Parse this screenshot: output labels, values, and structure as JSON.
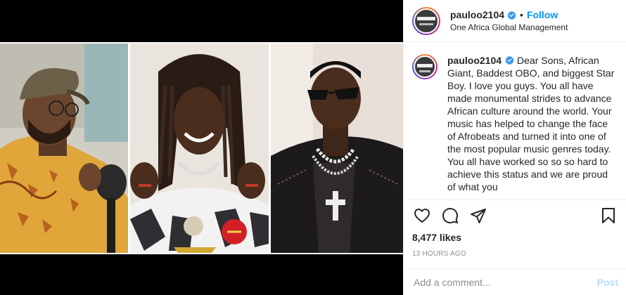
{
  "post": {
    "username": "pauloo2104",
    "dot": "•",
    "follow_label": "Follow",
    "location": "One Africa Global Management",
    "caption": "Dear Sons, African Giant, Baddest OBO, and biggest Star Boy. I love you guys. You all have made monumental strides to advance African culture around the world. Your music has helped to change the face of Afrobeats and turned it into one of the most popular music genres today. You all have worked so so so hard to achieve this status and we are proud of what you",
    "likes": "8,477 likes",
    "timestamp": "13 HOURS AGO"
  },
  "comment": {
    "placeholder": "Add a comment...",
    "post_label": "Post"
  },
  "icons": {
    "verified": "verified-badge-icon",
    "like": "heart-icon",
    "comment": "comment-icon",
    "share": "share-icon",
    "save": "bookmark-icon"
  },
  "colors": {
    "follow": "#0095f6",
    "verified": "#3897f0",
    "post_disabled": "#b2dffc"
  }
}
